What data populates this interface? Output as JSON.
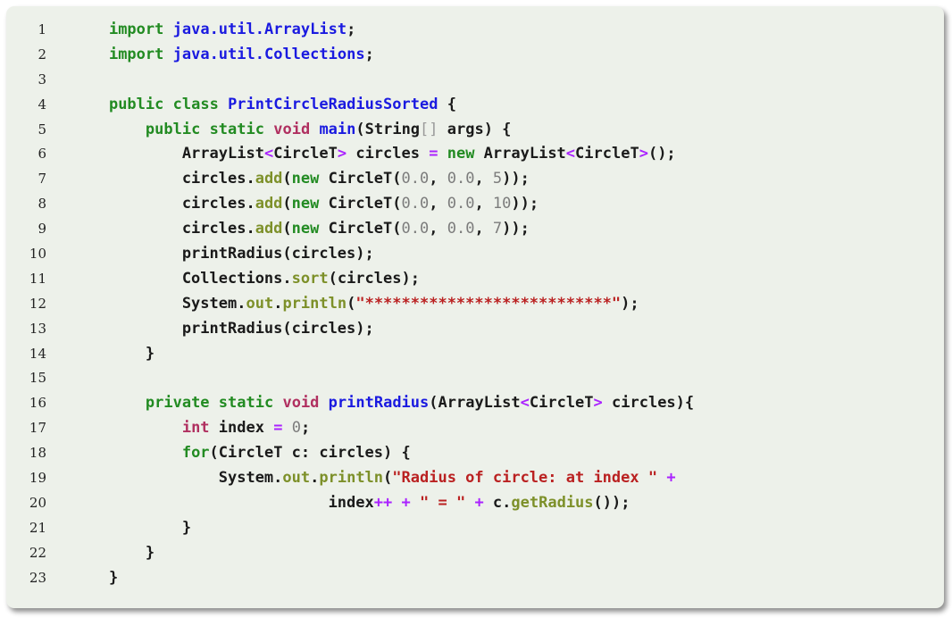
{
  "colors": {
    "background": "#edf1ea",
    "keyword": "#228b22",
    "function_name": "#1a1ae0",
    "type": "#b03060",
    "string": "#ba2121",
    "number": "#7c7c7c",
    "operator": "#aa22ff",
    "attribute": "#7d9029",
    "text": "#1a1a1a"
  },
  "code": {
    "lines": [
      {
        "n": "1",
        "tokens": [
          [
            "    ",
            "id"
          ],
          [
            "import",
            "kw"
          ],
          [
            " ",
            "id"
          ],
          [
            "java.util.ArrayList",
            "fn"
          ],
          [
            ";",
            "id"
          ]
        ]
      },
      {
        "n": "2",
        "tokens": [
          [
            "    ",
            "id"
          ],
          [
            "import",
            "kw"
          ],
          [
            " ",
            "id"
          ],
          [
            "java.util.Collections",
            "fn"
          ],
          [
            ";",
            "id"
          ]
        ]
      },
      {
        "n": "3",
        "tokens": []
      },
      {
        "n": "4",
        "tokens": [
          [
            "    ",
            "id"
          ],
          [
            "public",
            "kw"
          ],
          [
            " ",
            "id"
          ],
          [
            "class",
            "kw"
          ],
          [
            " ",
            "id"
          ],
          [
            "PrintCircleRadiusSorted",
            "fn"
          ],
          [
            " {",
            "id"
          ]
        ]
      },
      {
        "n": "5",
        "tokens": [
          [
            "        ",
            "id"
          ],
          [
            "public",
            "kw"
          ],
          [
            " ",
            "id"
          ],
          [
            "static",
            "kw"
          ],
          [
            " ",
            "id"
          ],
          [
            "void",
            "ty"
          ],
          [
            " ",
            "id"
          ],
          [
            "main",
            "fn"
          ],
          [
            "(String",
            "id"
          ],
          [
            "[]",
            "brk"
          ],
          [
            " args) {",
            "id"
          ]
        ]
      },
      {
        "n": "6",
        "tokens": [
          [
            "            ArrayList",
            "id"
          ],
          [
            "<",
            "op"
          ],
          [
            "CircleT",
            "id"
          ],
          [
            ">",
            "op"
          ],
          [
            " circles ",
            "id"
          ],
          [
            "=",
            "op"
          ],
          [
            " ",
            "id"
          ],
          [
            "new",
            "kw"
          ],
          [
            " ArrayList",
            "id"
          ],
          [
            "<",
            "op"
          ],
          [
            "CircleT",
            "id"
          ],
          [
            ">",
            "op"
          ],
          [
            "();",
            "id"
          ]
        ]
      },
      {
        "n": "7",
        "tokens": [
          [
            "            circles.",
            "id"
          ],
          [
            "add",
            "attr"
          ],
          [
            "(",
            "id"
          ],
          [
            "new",
            "kw"
          ],
          [
            " CircleT(",
            "id"
          ],
          [
            "0.0",
            "num"
          ],
          [
            ", ",
            "id"
          ],
          [
            "0.0",
            "num"
          ],
          [
            ", ",
            "id"
          ],
          [
            "5",
            "num"
          ],
          [
            "));",
            "id"
          ]
        ]
      },
      {
        "n": "8",
        "tokens": [
          [
            "            circles.",
            "id"
          ],
          [
            "add",
            "attr"
          ],
          [
            "(",
            "id"
          ],
          [
            "new",
            "kw"
          ],
          [
            " CircleT(",
            "id"
          ],
          [
            "0.0",
            "num"
          ],
          [
            ", ",
            "id"
          ],
          [
            "0.0",
            "num"
          ],
          [
            ", ",
            "id"
          ],
          [
            "10",
            "num"
          ],
          [
            "));",
            "id"
          ]
        ]
      },
      {
        "n": "9",
        "tokens": [
          [
            "            circles.",
            "id"
          ],
          [
            "add",
            "attr"
          ],
          [
            "(",
            "id"
          ],
          [
            "new",
            "kw"
          ],
          [
            " CircleT(",
            "id"
          ],
          [
            "0.0",
            "num"
          ],
          [
            ", ",
            "id"
          ],
          [
            "0.0",
            "num"
          ],
          [
            ", ",
            "id"
          ],
          [
            "7",
            "num"
          ],
          [
            "));",
            "id"
          ]
        ]
      },
      {
        "n": "10",
        "tokens": [
          [
            "            printRadius(circles);",
            "id"
          ]
        ]
      },
      {
        "n": "11",
        "tokens": [
          [
            "            Collections.",
            "id"
          ],
          [
            "sort",
            "attr"
          ],
          [
            "(circles);",
            "id"
          ]
        ]
      },
      {
        "n": "12",
        "tokens": [
          [
            "            System.",
            "id"
          ],
          [
            "out",
            "attr"
          ],
          [
            ".",
            "id"
          ],
          [
            "println",
            "attr"
          ],
          [
            "(",
            "id"
          ],
          [
            "\"***************************\"",
            "str"
          ],
          [
            ");",
            "id"
          ]
        ]
      },
      {
        "n": "13",
        "tokens": [
          [
            "            printRadius(circles);",
            "id"
          ]
        ]
      },
      {
        "n": "14",
        "tokens": [
          [
            "        }",
            "id"
          ]
        ]
      },
      {
        "n": "15",
        "tokens": []
      },
      {
        "n": "16",
        "tokens": [
          [
            "        ",
            "id"
          ],
          [
            "private",
            "kw"
          ],
          [
            " ",
            "id"
          ],
          [
            "static",
            "kw"
          ],
          [
            " ",
            "id"
          ],
          [
            "void",
            "ty"
          ],
          [
            " ",
            "id"
          ],
          [
            "printRadius",
            "fn"
          ],
          [
            "(ArrayList",
            "id"
          ],
          [
            "<",
            "op"
          ],
          [
            "CircleT",
            "id"
          ],
          [
            ">",
            "op"
          ],
          [
            " circles){",
            "id"
          ]
        ]
      },
      {
        "n": "17",
        "tokens": [
          [
            "            ",
            "id"
          ],
          [
            "int",
            "ty"
          ],
          [
            " index ",
            "id"
          ],
          [
            "=",
            "op"
          ],
          [
            " ",
            "id"
          ],
          [
            "0",
            "num"
          ],
          [
            ";",
            "id"
          ]
        ]
      },
      {
        "n": "18",
        "tokens": [
          [
            "            ",
            "id"
          ],
          [
            "for",
            "kw"
          ],
          [
            "(CircleT c: circles) {",
            "id"
          ]
        ]
      },
      {
        "n": "19",
        "tokens": [
          [
            "                System.",
            "id"
          ],
          [
            "out",
            "attr"
          ],
          [
            ".",
            "id"
          ],
          [
            "println",
            "attr"
          ],
          [
            "(",
            "id"
          ],
          [
            "\"Radius of circle: at index \"",
            "str"
          ],
          [
            " ",
            "id"
          ],
          [
            "+",
            "op"
          ]
        ]
      },
      {
        "n": "20",
        "tokens": [
          [
            "                            index",
            "id"
          ],
          [
            "++",
            "op"
          ],
          [
            " ",
            "id"
          ],
          [
            "+",
            "op"
          ],
          [
            " ",
            "id"
          ],
          [
            "\" = \"",
            "str"
          ],
          [
            " ",
            "id"
          ],
          [
            "+",
            "op"
          ],
          [
            " c.",
            "id"
          ],
          [
            "getRadius",
            "attr"
          ],
          [
            "());",
            "id"
          ]
        ]
      },
      {
        "n": "21",
        "tokens": [
          [
            "            }",
            "id"
          ]
        ]
      },
      {
        "n": "22",
        "tokens": [
          [
            "        }",
            "id"
          ]
        ]
      },
      {
        "n": "23",
        "tokens": [
          [
            "    }",
            "id"
          ]
        ]
      }
    ]
  }
}
